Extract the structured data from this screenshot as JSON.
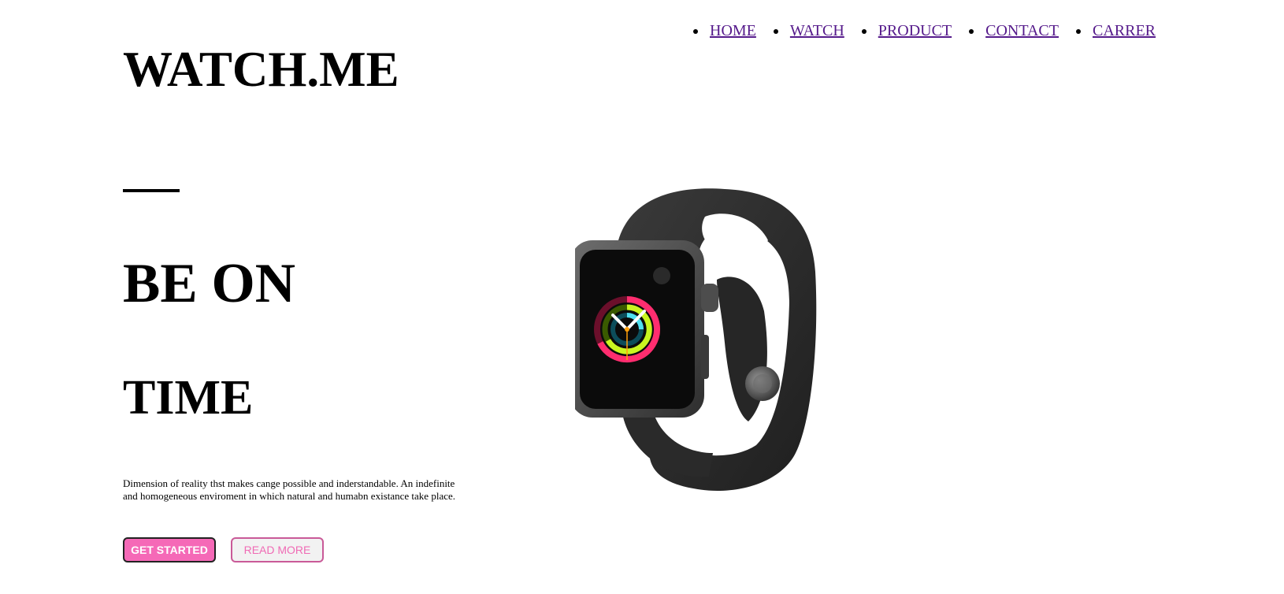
{
  "nav": {
    "items": [
      {
        "label": "HOME"
      },
      {
        "label": "WATCH"
      },
      {
        "label": "PRODUCT"
      },
      {
        "label": "CONTACT"
      },
      {
        "label": "CARRER"
      }
    ]
  },
  "logo": "WATCH.ME",
  "hero": {
    "headline_line1": "BE ON",
    "headline_line2": "TIME",
    "description": "Dimension of reality thst makes cange possible and inderstandable. An indefinite and homogeneous enviroment in which natural and humabn existance take place.",
    "primary_button": "GET STARTED",
    "secondary_button": "READ MORE"
  },
  "colors": {
    "accent": "#f569b7",
    "link": "#551A8B"
  },
  "icons": {
    "product_image": "smartwatch-image"
  }
}
